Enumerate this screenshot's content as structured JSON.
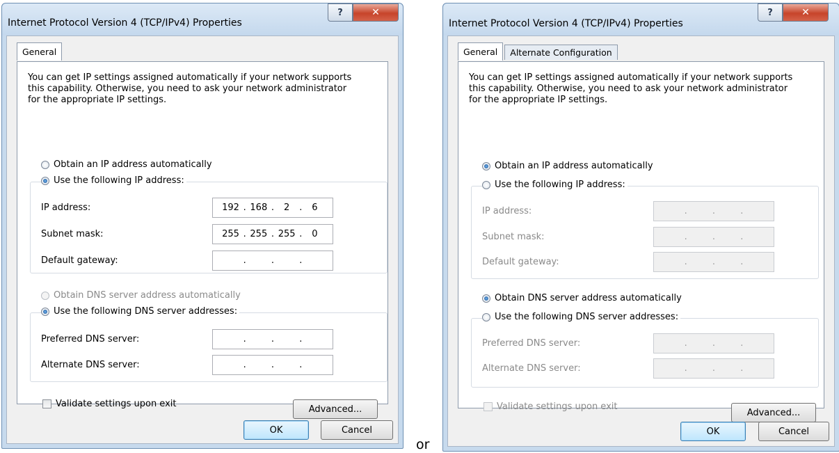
{
  "or_text": "or",
  "dialog1": {
    "title": "Internet Protocol Version 4 (TCP/IPv4) Properties",
    "help_label": "?",
    "close_label": "✕",
    "tabs": [
      "General"
    ],
    "description": [
      "You can get IP settings assigned automatically if your network supports",
      "this capability. Otherwise, you need to ask your network administrator",
      "for the appropriate IP settings."
    ],
    "obtain_ip_auto": "Obtain an IP address automatically",
    "use_following_ip": "Use the following IP address:",
    "ip_address_label": "IP address:",
    "ip_address": [
      "192",
      "168",
      "2",
      "6"
    ],
    "subnet_mask_label": "Subnet mask:",
    "subnet_mask": [
      "255",
      "255",
      "255",
      "0"
    ],
    "default_gateway_label": "Default gateway:",
    "default_gateway": [
      "",
      "",
      "",
      ""
    ],
    "obtain_dns_auto": "Obtain DNS server address automatically",
    "use_following_dns": "Use the following DNS server addresses:",
    "preferred_dns_label": "Preferred DNS server:",
    "preferred_dns": [
      "",
      "",
      "",
      ""
    ],
    "alternate_dns_label": "Alternate DNS server:",
    "alternate_dns": [
      "",
      "",
      "",
      ""
    ],
    "validate_label": "Validate settings upon exit",
    "advanced_label": "Advanced...",
    "ok_label": "OK",
    "cancel_label": "Cancel",
    "selected_ip_option": "use_following",
    "selected_dns_option": "use_following"
  },
  "dialog2": {
    "title": "Internet Protocol Version 4 (TCP/IPv4) Properties",
    "help_label": "?",
    "close_label": "✕",
    "tabs": [
      "General",
      "Alternate Configuration"
    ],
    "description": [
      "You can get IP settings assigned automatically if your network supports",
      "this capability. Otherwise, you need to ask your network administrator",
      "for the appropriate IP settings."
    ],
    "obtain_ip_auto": "Obtain an IP address automatically",
    "use_following_ip": "Use the following IP address:",
    "ip_address_label": "IP address:",
    "subnet_mask_label": "Subnet mask:",
    "default_gateway_label": "Default gateway:",
    "obtain_dns_auto": "Obtain DNS server address automatically",
    "use_following_dns": "Use the following DNS server addresses:",
    "preferred_dns_label": "Preferred DNS server:",
    "alternate_dns_label": "Alternate DNS server:",
    "validate_label": "Validate settings upon exit",
    "advanced_label": "Advanced...",
    "ok_label": "OK",
    "cancel_label": "Cancel",
    "selected_ip_option": "obtain_auto",
    "selected_dns_option": "obtain_auto"
  },
  "icons": {
    "help": "help-icon",
    "close": "close-icon",
    "radio": "radio-icon",
    "checkbox": "checkbox-icon"
  }
}
